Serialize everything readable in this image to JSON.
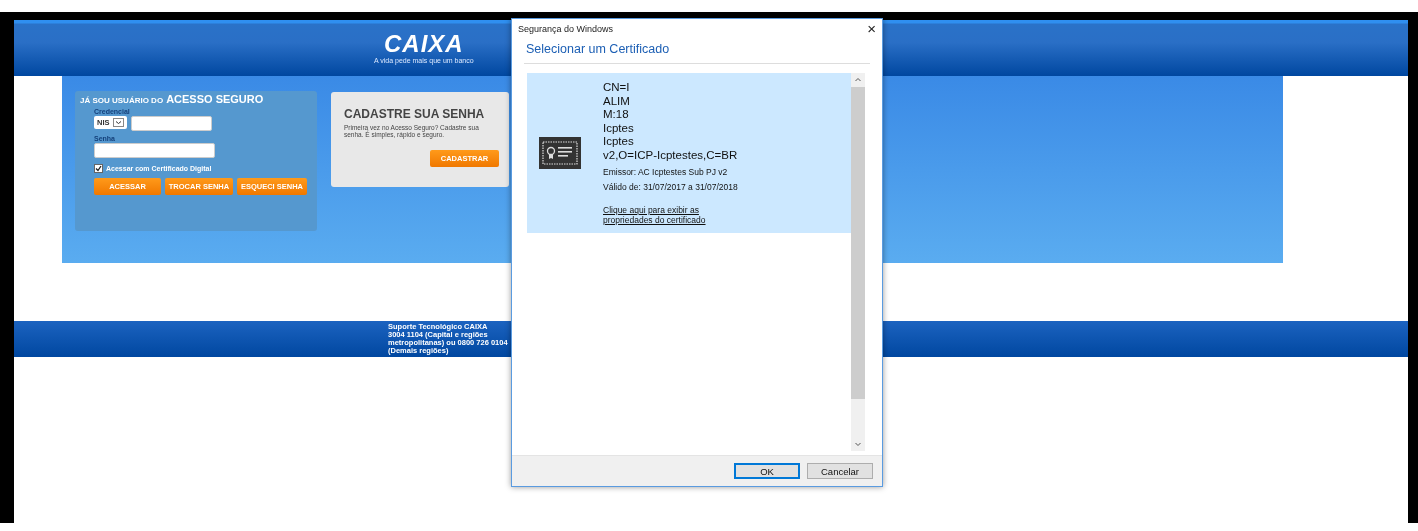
{
  "page": {
    "logo": {
      "wordmark": "CAIXA",
      "tagline": "A vida pede mais que um banco"
    },
    "login": {
      "title_prefix": "JÁ SOU USUÁRIO DO",
      "title_main": "ACESSO SEGURO",
      "credential_label": "Credencial",
      "credential_type": "NIS",
      "password_label": "Senha",
      "certificate": {
        "label": "Acessar com Certificado Digital",
        "checked": true
      },
      "buttons": [
        "ACESSAR",
        "TROCAR SENHA",
        "ESQUECI SENHA"
      ]
    },
    "register": {
      "title": "CADASTRE SUA SENHA",
      "text": "Primeira vez no Acesso Seguro? Cadastre sua senha. É simples, rápido e seguro.",
      "button": "CADASTRAR"
    },
    "footer": {
      "lines": [
        "Suporte Tecnológico CAIXA",
        "3004 1104 (Capital e regiões",
        "metropolitanas) ou 0800 726 0104",
        "(Demais regiões)"
      ]
    }
  },
  "dialog": {
    "title": "Segurança do Windows",
    "close": "×",
    "heading": "Selecionar um Certificado",
    "certificates": [
      {
        "subject_lines": [
          "CN=I",
          "ALIM",
          "M:18",
          "Icptes",
          "Icptes",
          "v2,O=ICP-Icptestes,C=BR"
        ],
        "issuer": "Emissor: AC Icptestes Sub PJ v2",
        "validity": "Válido de: 31/07/2017 a 31/07/2018",
        "link": "Clique aqui para exibir as propriedades do certificado",
        "selected": true
      }
    ],
    "buttons": [
      {
        "label": "OK",
        "default": true
      },
      {
        "label": "Cancelar",
        "default": false
      }
    ]
  }
}
